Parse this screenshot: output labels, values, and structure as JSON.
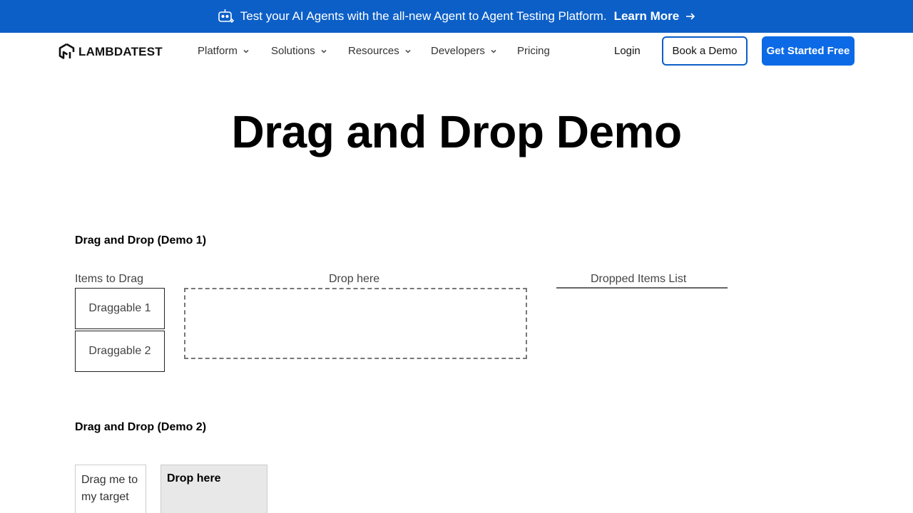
{
  "banner": {
    "message": "Test your AI Agents with the all-new Agent to Agent Testing Platform.",
    "learn_more": "Learn More",
    "bot_icon": "robot-icon",
    "arrow_icon": "arrow-right-icon",
    "background_color": "#0c5fc7"
  },
  "nav": {
    "logo_text": "LAMBDATEST",
    "items": [
      {
        "label": "Platform",
        "has_dropdown": true
      },
      {
        "label": "Solutions",
        "has_dropdown": true
      },
      {
        "label": "Resources",
        "has_dropdown": true
      },
      {
        "label": "Developers",
        "has_dropdown": true
      },
      {
        "label": "Pricing",
        "has_dropdown": false
      }
    ],
    "login": "Login",
    "book_demo": "Book a Demo",
    "get_started": "Get Started Free",
    "accent_color": "#0c6ae6"
  },
  "page": {
    "title": "Drag and Drop Demo"
  },
  "demo1": {
    "heading": "Drag and Drop (Demo 1)",
    "items_label": "Items to Drag",
    "drop_label": "Drop here",
    "dropped_list_label": "Dropped Items List",
    "draggables": [
      "Draggable 1",
      "Draggable 2"
    ]
  },
  "demo2": {
    "heading": "Drag and Drop (Demo 2)",
    "drag_text": "Drag me to my target",
    "drop_text": "Drop here"
  }
}
